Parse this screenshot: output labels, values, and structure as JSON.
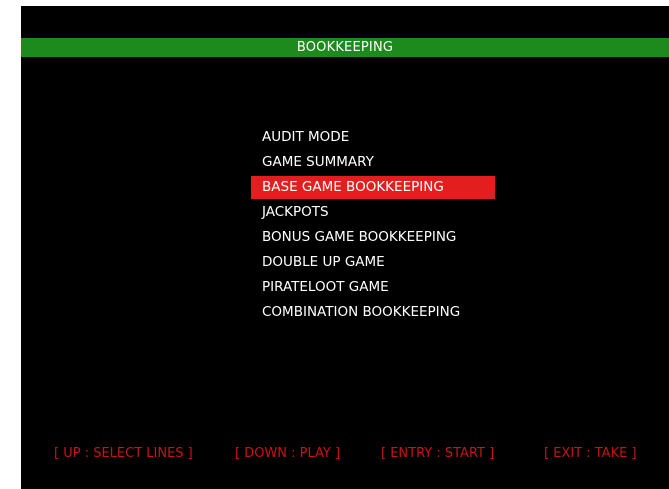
{
  "header": {
    "title": "BOOKKEEPING"
  },
  "menu": {
    "selected_index": 2,
    "items": [
      {
        "label": "AUDIT MODE"
      },
      {
        "label": "GAME SUMMARY"
      },
      {
        "label": "BASE GAME BOOKKEEPING"
      },
      {
        "label": "JACKPOTS"
      },
      {
        "label": "BONUS GAME BOOKKEEPING"
      },
      {
        "label": "DOUBLE UP GAME"
      },
      {
        "label": "PIRATELOOT GAME"
      },
      {
        "label": "COMBINATION BOOKKEEPING"
      }
    ]
  },
  "footer": {
    "up": "[ UP : SELECT LINES ]",
    "down": "[ DOWN : PLAY ]",
    "entry": "[ ENTRY : START ]",
    "exit": "[ EXIT : TAKE ]"
  },
  "colors": {
    "background": "#000000",
    "title_bar": "#1d8a1d",
    "selection": "#e31e1e",
    "menu_text": "#ffffff",
    "hint_text": "#c81414"
  }
}
